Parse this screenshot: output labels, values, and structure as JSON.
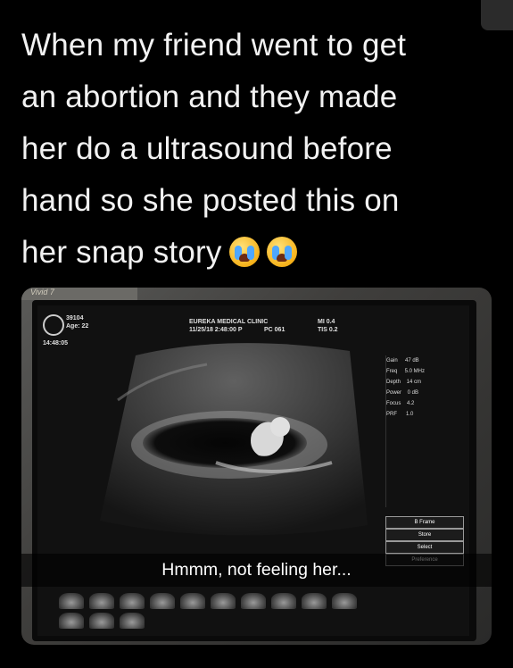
{
  "post": {
    "caption": "When my friend went to get\nan abortion and they made\nher do a ultrasound before\nhand so she posted this on\nher snap story",
    "caption_emoji": "loudly-crying-face-emoji x2"
  },
  "photo": {
    "snap_caption": "Hmmm, not feeling her...",
    "brand_text": "Vivid 7",
    "screen": {
      "patient_id": "39104",
      "age": "Age: 22",
      "timestamp": "14:48:05",
      "clinic": "EUREKA MEDICAL CLINIC",
      "clinic_date": "11/25/18 2:48:00 P",
      "code1": "PC 061",
      "code2": "MI 0.4",
      "code3": "TIS 0.2"
    }
  }
}
